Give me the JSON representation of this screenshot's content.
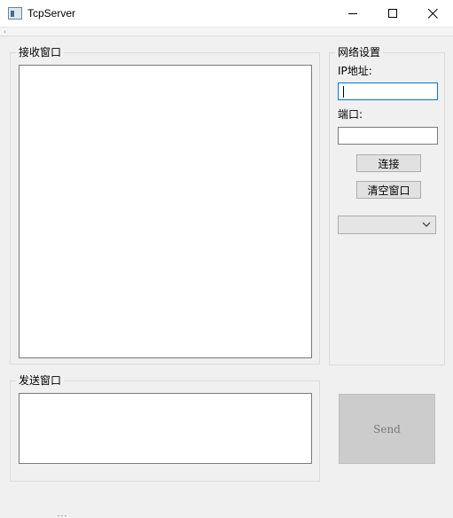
{
  "window": {
    "title": "TcpServer",
    "icons": {
      "app": "window-app-icon",
      "minimize": "minimize-icon",
      "maximize": "maximize-icon",
      "close": "close-icon"
    }
  },
  "receive_group": {
    "title": "接收窗口",
    "content": ""
  },
  "network_group": {
    "title": "网络设置",
    "ip_label": "IP地址:",
    "ip_value": "",
    "port_label": "端口:",
    "port_value": "",
    "connect_label": "连接",
    "clear_label": "清空窗口",
    "client_select_value": ""
  },
  "send_group": {
    "title": "发送窗口",
    "content": ""
  },
  "send_button": {
    "label": "Send"
  },
  "colors": {
    "focus_border": "#0078d7",
    "background": "#f0f0f0",
    "send_disabled": "#cccccc"
  }
}
